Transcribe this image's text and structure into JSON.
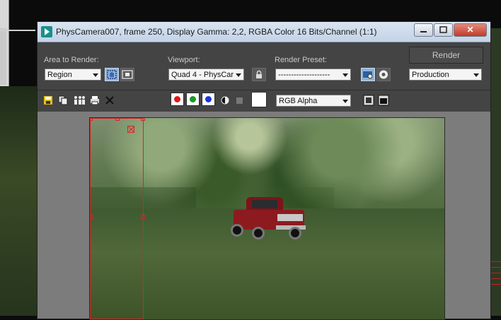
{
  "window": {
    "title": "PhysCamera007, frame 250, Display Gamma: 2,2, RGBA Color 16 Bits/Channel (1:1)",
    "minimize_label": "",
    "maximize_label": "",
    "close_label": "✕"
  },
  "area_to_render": {
    "label": "Area to Render:",
    "value": "Region"
  },
  "viewport": {
    "label": "Viewport:",
    "value": "Quad 4 - PhysCar"
  },
  "render_preset": {
    "label": "Render Preset:",
    "value": "--------------------"
  },
  "render_button": {
    "label": "Render"
  },
  "production": {
    "value": "Production"
  },
  "channel": {
    "value": "RGB Alpha"
  },
  "colors": {
    "red": "#e01818",
    "green": "#1a9a22",
    "blue": "#1d35d8",
    "region": "#d3262a"
  }
}
